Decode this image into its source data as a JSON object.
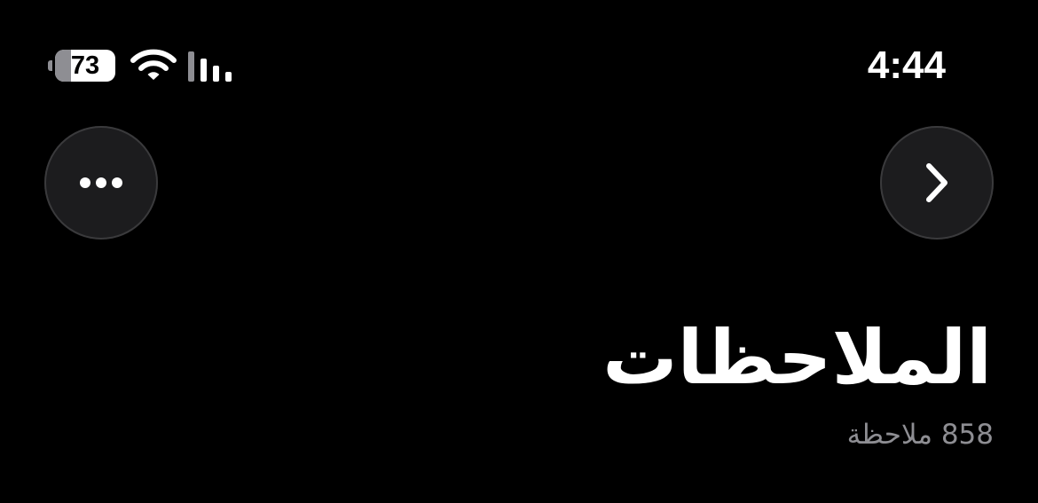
{
  "status_bar": {
    "battery_level": "73",
    "battery_fraction": 0.73,
    "time": "4:44",
    "icons": {
      "battery": "battery-icon",
      "wifi": "wifi-icon",
      "signal": "cellular-signal-icon"
    }
  },
  "toolbar": {
    "more_icon": "ellipsis-icon",
    "forward_icon": "chevron-right-icon"
  },
  "header": {
    "title": "الملاحظات",
    "subtitle": "858 ملاحظة"
  },
  "colors": {
    "background": "#000000",
    "text_primary": "#ffffff",
    "text_secondary": "#8e8e93",
    "button_fill": "#1c1c1e",
    "button_border": "#3a3a3c"
  }
}
